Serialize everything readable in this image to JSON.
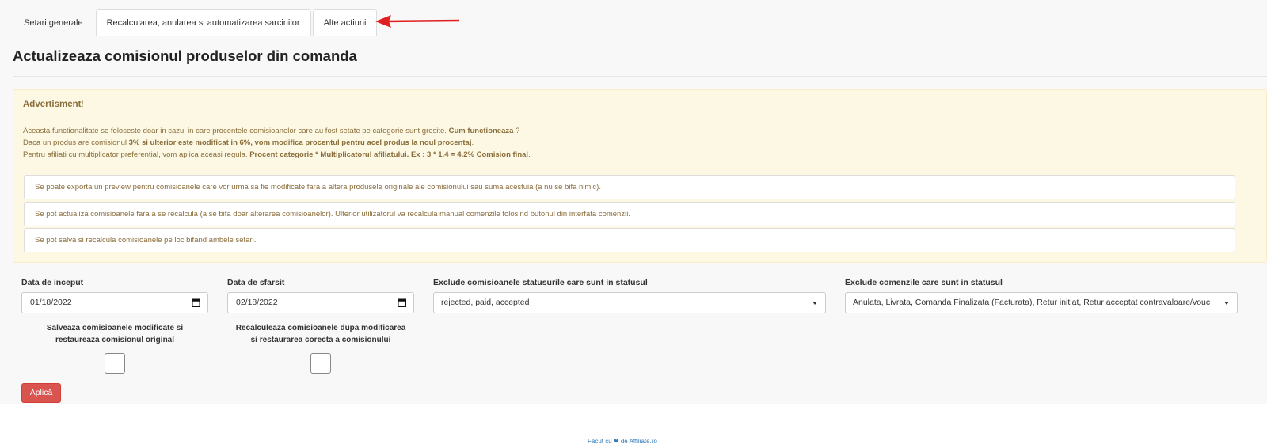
{
  "tabs": [
    {
      "label": "Setari generale"
    },
    {
      "label": "Recalcularea, anularea si automatizarea sarcinilor"
    },
    {
      "label": "Alte actiuni"
    }
  ],
  "page_title": "Actualizeaza comisionul produselor din comanda",
  "alert": {
    "title": "Advertisment",
    "title_suffix": "!",
    "line1_text": "Aceasta functionalitate se foloseste doar in cazul in care procentele comisioanelor care au fost setate pe categorie sunt gresite. ",
    "line1_bold": "Cum functioneaza",
    "line1_end": " ?",
    "line2_text": "Daca un produs are comisionul ",
    "line2_bold": "3% si ulterior este modificat in 6%, vom modifica procentul pentru acel produs la noul procentaj",
    "line2_end": ".",
    "line3_text": "Pentru afiliati cu multiplicator preferential, vom aplica aceasi regula. ",
    "line3_bold": "Procent categorie * Multiplicatorul afiliatului. Ex : 3 * 1.4 = 4.2% Comision final",
    "line3_end": ".",
    "notes": [
      "Se poate exporta un preview pentru comisioanele care vor urma sa fie modificate fara a altera produsele originale ale comisionului sau suma acestuia (a nu se bifa nimic).",
      "Se pot actualiza comisioanele fara a se recalcula (a se bifa doar alterarea comisioanelor). Ulterior utilizatorul va recalcula manual comenzile folosind butonul din interfata comenzii.",
      "Se pot salva si recalcula comisioanele pe loc bifand ambele setari."
    ]
  },
  "form": {
    "start_label": "Data de inceput",
    "start_value": "01/18/2022",
    "end_label": "Data de sfarsit",
    "end_value": "02/18/2022",
    "exclude_statuses_label": "Exclude comisioanele statusurile care sunt in statusul",
    "exclude_statuses_value": "rejected, paid, accepted",
    "exclude_orders_label": "Exclude comenzile care sunt in statusul",
    "exclude_orders_value": "Anulata, Livrata, Comanda Finalizata (Facturata), Retur initiat, Retur acceptat contravaloare/vouc",
    "save_label_line1": "Salveaza comisioanele modificate si",
    "save_label_line2": "restaureaza comisionul original",
    "recalc_label_line1": "Recalculeaza comisioanele dupa modificarea",
    "recalc_label_line2": "si restaurarea corecta a comisionului",
    "apply_label": "Aplică"
  },
  "footer": {
    "link": "Făcut cu ❤ de Affiliate.ro"
  },
  "colors": {
    "accent_red": "#d9534f",
    "arrow": "#e02020",
    "alert_bg": "#fcf8e3",
    "alert_text": "#8a6d3b"
  }
}
